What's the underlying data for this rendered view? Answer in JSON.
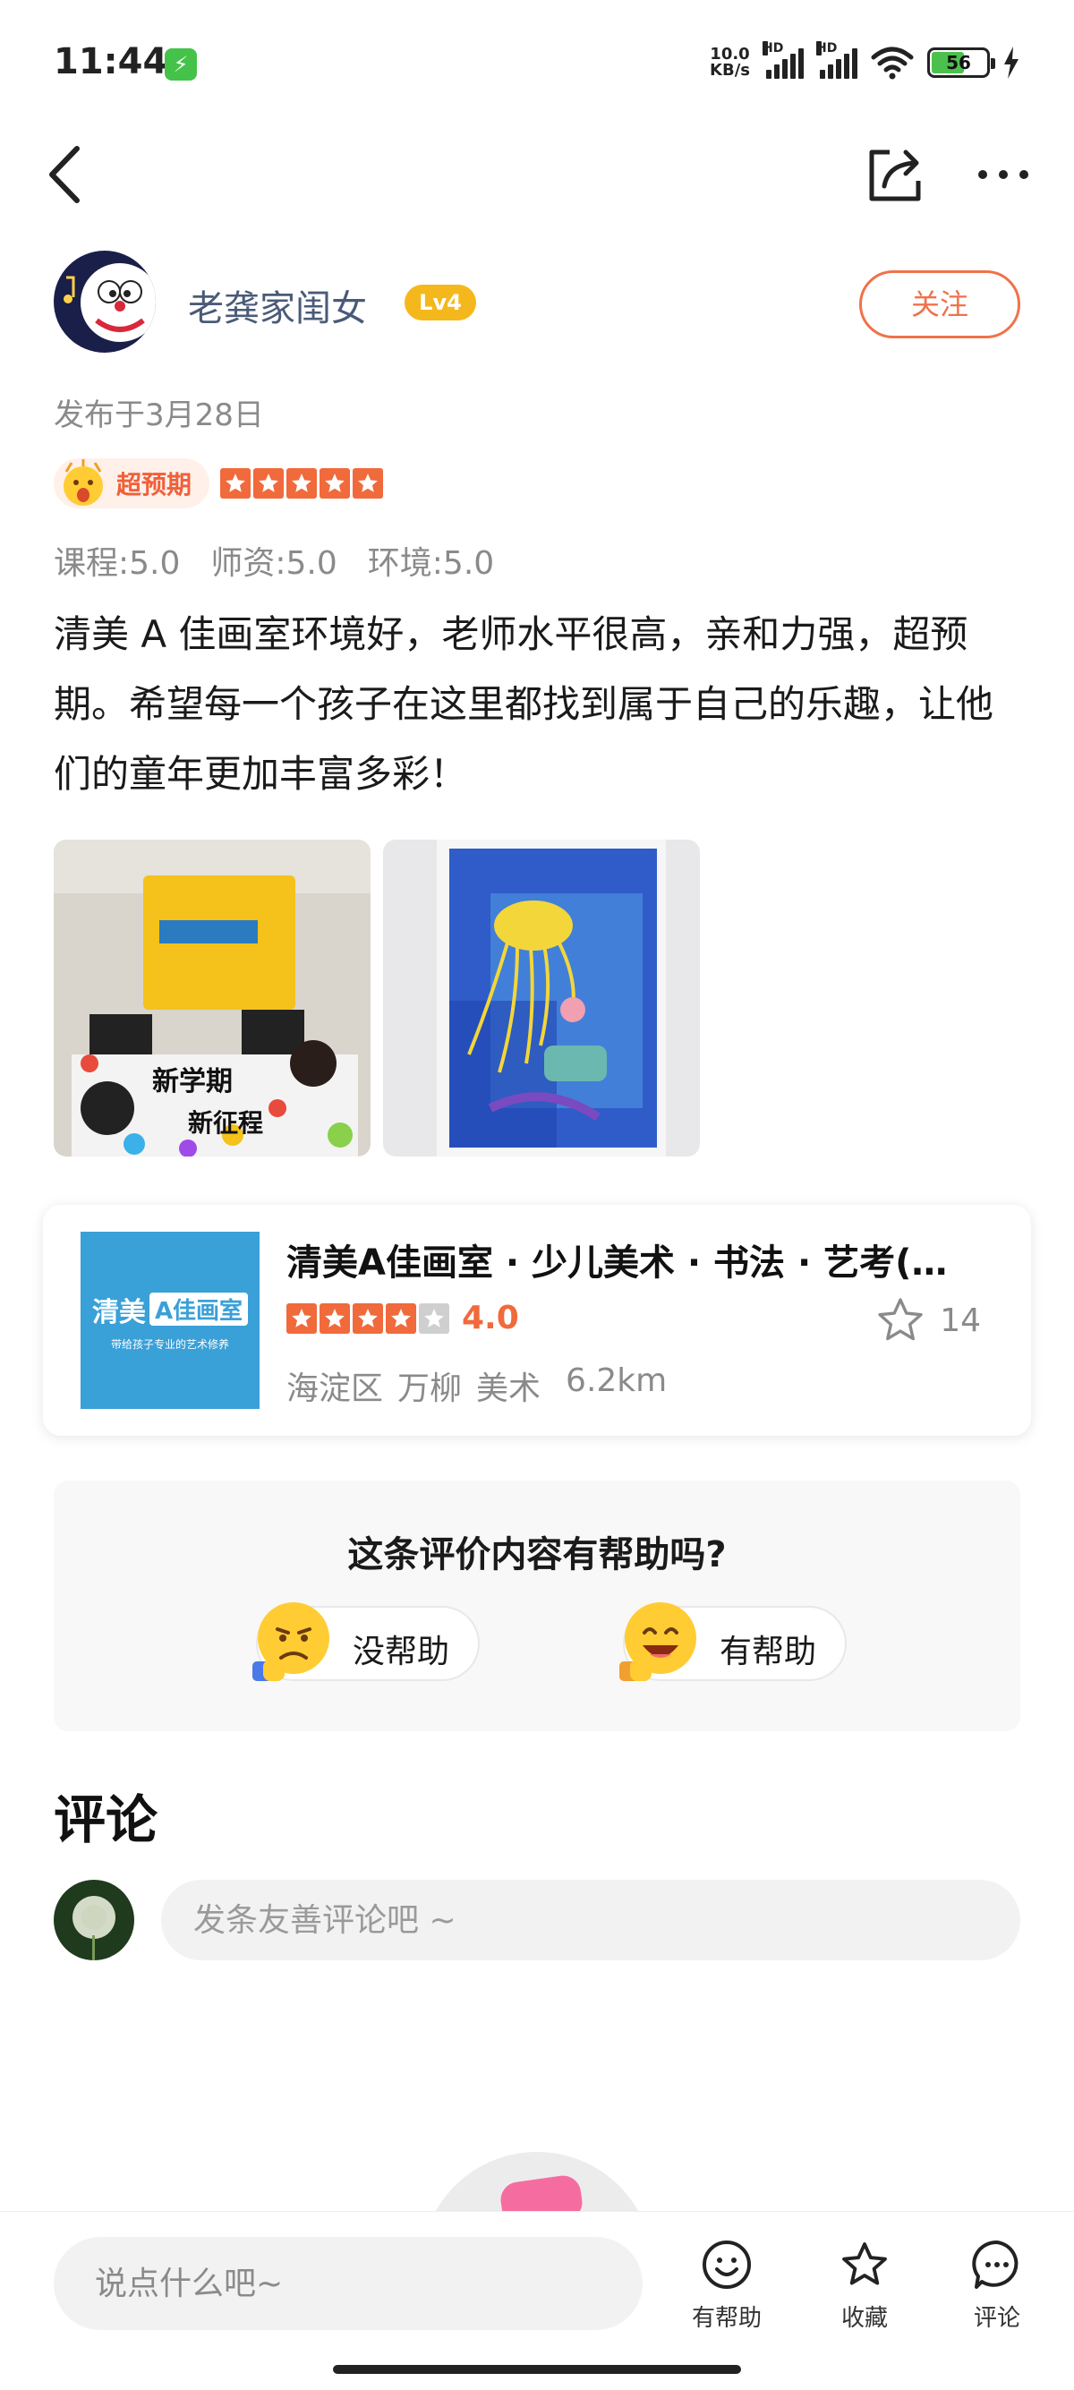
{
  "status_bar": {
    "time": "11:44",
    "net_speed_value": "10.0",
    "net_speed_unit": "KB/s",
    "hd_label_1": "HD",
    "hd_label_2": "HD",
    "battery": "56"
  },
  "author": {
    "name": "老龚家闺女",
    "level": "Lv4",
    "follow_label": "关注"
  },
  "publish_date": "发布于3月28日",
  "rating": {
    "tag": "超预期",
    "stars": 5
  },
  "scores": {
    "course": "课程:5.0",
    "teacher": "师资:5.0",
    "environment": "环境:5.0"
  },
  "review_text": "清美 A 佳画室环境好，老师水平很高，亲和力强，超预期。希望每一个孩子在这里都找到属于自己的乐趣，让他们的童年更加丰富多彩！",
  "photos": {
    "photo1_text_1": "新学期",
    "photo1_text_2": "新征程"
  },
  "shop": {
    "name": "清美A佳画室 · 少儿美术 · 书法 · 艺考(…",
    "score": "4.0",
    "stars": 4,
    "fav_count": "14",
    "district": "海淀区",
    "area": "万柳",
    "category": "美术",
    "distance": "6.2km",
    "logo_brand_1": "清美",
    "logo_brand_2": "A佳画室",
    "logo_slogan": "带给孩子专业的艺术修养"
  },
  "helpful": {
    "question": "这条评价内容有帮助吗?",
    "no_label": "没帮助",
    "yes_label": "有帮助"
  },
  "comments": {
    "title": "评论",
    "input_placeholder": "发条友善评论吧 ~"
  },
  "bottom_bar": {
    "input_placeholder": "说点什么吧~",
    "helpful": "有帮助",
    "favorite": "收藏",
    "comment": "评论"
  },
  "colors": {
    "accent": "#f06a3c",
    "follow": "#f0724a",
    "level_badge": "#f5b81c",
    "author_name": "#4a5a78",
    "muted": "#8a8a8a"
  }
}
